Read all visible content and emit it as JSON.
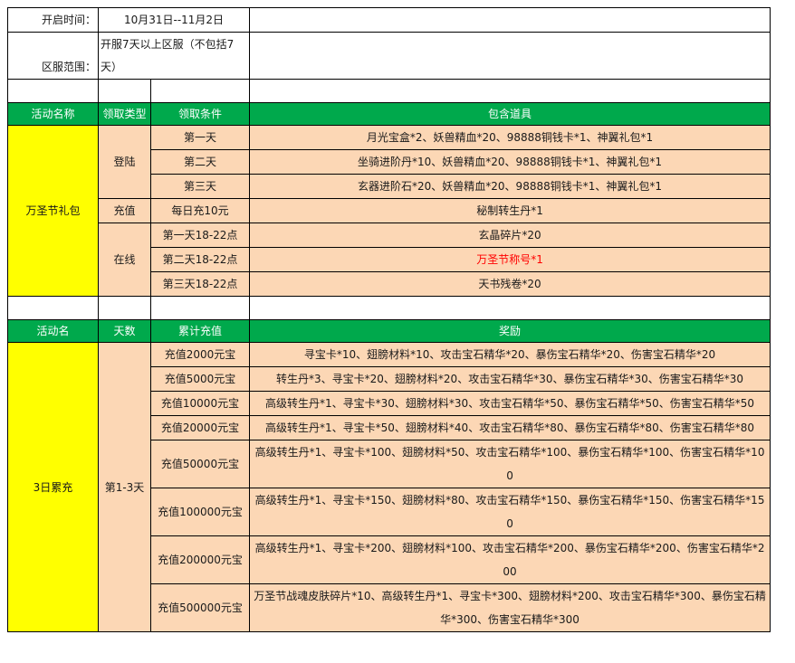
{
  "info": {
    "open_time_label": "开启时间：",
    "open_time_value": "10月31日--11月2日",
    "range_label": "区服范围：",
    "range_value": "开服7天以上区服（不包括7天）"
  },
  "section1": {
    "headers": [
      "活动名称",
      "领取类型",
      "领取条件",
      "包含道具"
    ],
    "activity_name": "万圣节礼包",
    "groups": [
      {
        "type": "登陆",
        "rows": [
          {
            "condition": "第一天",
            "items": "月光宝盒*2、妖兽精血*20、98888铜钱卡*1、神翼礼包*1"
          },
          {
            "condition": "第二天",
            "items": "坐骑进阶丹*10、妖兽精血*20、98888铜钱卡*1、神翼礼包*1"
          },
          {
            "condition": "第三天",
            "items": "玄器进阶石*20、妖兽精血*20、98888铜钱卡*1、神翼礼包*1"
          }
        ]
      },
      {
        "type": "充值",
        "rows": [
          {
            "condition": "每日充10元",
            "items": "秘制转生丹*1"
          }
        ]
      },
      {
        "type": "在线",
        "rows": [
          {
            "condition": "第一天18-22点",
            "items": "玄晶碎片*20"
          },
          {
            "condition": "第二天18-22点",
            "items": "万圣节称号*1"
          },
          {
            "condition": "第三天18-22点",
            "items": "天书残卷*20"
          }
        ]
      }
    ]
  },
  "section2": {
    "headers": [
      "活动名",
      "天数",
      "累计充值",
      "奖励"
    ],
    "activity_name": "3日累充",
    "days": "第1-3天",
    "rows": [
      {
        "recharge": "充值2000元宝",
        "reward": "寻宝卡*10、翅膀材料*10、攻击宝石精华*20、暴伤宝石精华*20、伤害宝石精华*20"
      },
      {
        "recharge": "充值5000元宝",
        "reward": "转生丹*3、寻宝卡*20、翅膀材料*20、攻击宝石精华*30、暴伤宝石精华*30、伤害宝石精华*30"
      },
      {
        "recharge": "充值10000元宝",
        "reward": "高级转生丹*1、寻宝卡*30、翅膀材料*30、攻击宝石精华*50、暴伤宝石精华*50、伤害宝石精华*50"
      },
      {
        "recharge": "充值20000元宝",
        "reward": "高级转生丹*1、寻宝卡*50、翅膀材料*40、攻击宝石精华*80、暴伤宝石精华*80、伤害宝石精华*80"
      },
      {
        "recharge": "充值50000元宝",
        "reward": "高级转生丹*1、寻宝卡*100、翅膀材料*50、攻击宝石精华*100、暴伤宝石精华*100、伤害宝石精华*100"
      },
      {
        "recharge": "充值100000元宝",
        "reward": "高级转生丹*1、寻宝卡*150、翅膀材料*80、攻击宝石精华*150、暴伤宝石精华*150、伤害宝石精华*150"
      },
      {
        "recharge": "充值200000元宝",
        "reward": "高级转生丹*1、寻宝卡*200、翅膀材料*100、攻击宝石精华*200、暴伤宝石精华*200、伤害宝石精华*200"
      },
      {
        "recharge": "充值500000元宝",
        "reward": "万圣节战魂皮肤碎片*10、高级转生丹*1、寻宝卡*300、翅膀材料*200、攻击宝石精华*300、暴伤宝石精华*300、伤害宝石精华*300"
      }
    ]
  },
  "colors": {
    "header_green": "#00a94c",
    "name_yellow": "#ffff00",
    "cell_peach": "#fcd7b5",
    "highlight_red": "#ff0000"
  }
}
